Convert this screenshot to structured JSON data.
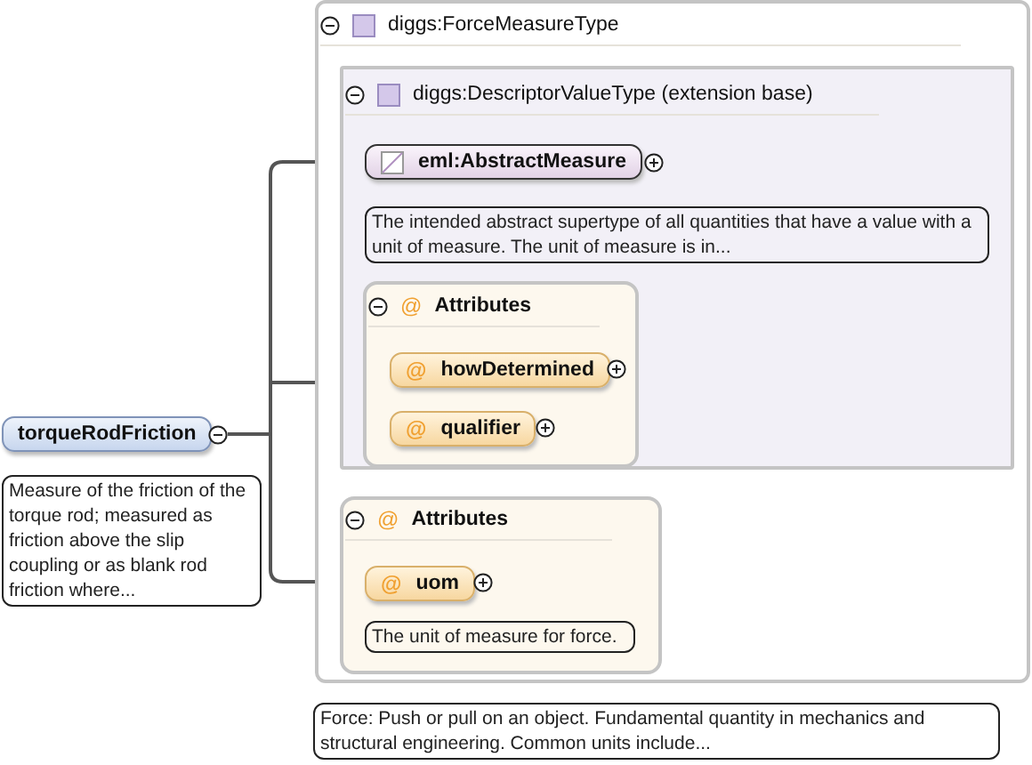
{
  "element": {
    "name": "torqueRodFriction",
    "expanded": true,
    "doc": "Measure of the friction of the torque rod; measured as friction above the slip coupling or as blank rod friction where..."
  },
  "type": {
    "name": "diggs:ForceMeasureType",
    "expanded": true,
    "doc": "Force: Push or pull on an object. Fundamental quantity in mechanics and structural engineering. Common units include...",
    "extension": {
      "name": "diggs:DescriptorValueType (extension base)",
      "expanded": true,
      "element": {
        "name": "eml:AbstractMeasure",
        "expanded": false,
        "doc": "The intended abstract supertype of all quantities that have a value with a unit of measure. The unit of measure is in..."
      },
      "attributes": {
        "marker": "@",
        "title": "Attributes",
        "expanded": true,
        "items": [
          {
            "marker": "@",
            "name": "howDetermined",
            "expanded": false
          },
          {
            "marker": "@",
            "name": "qualifier",
            "expanded": false
          }
        ]
      }
    },
    "attributes": {
      "marker": "@",
      "title": "Attributes",
      "expanded": true,
      "items": [
        {
          "marker": "@",
          "name": "uom",
          "expanded": false,
          "doc": "The unit of measure for force."
        }
      ]
    }
  }
}
